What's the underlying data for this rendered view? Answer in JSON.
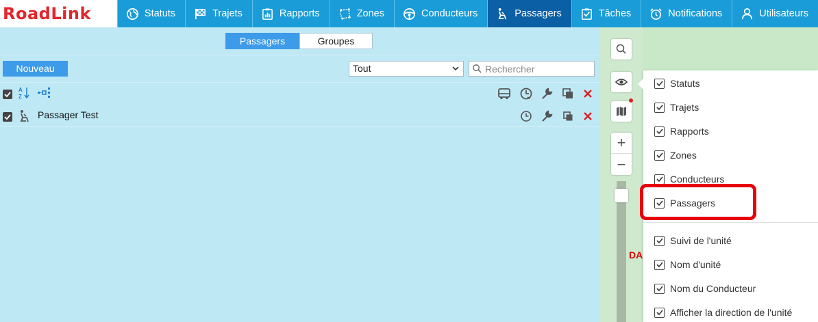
{
  "app": {
    "logo": "RoadLink"
  },
  "nav": {
    "items": [
      {
        "label": "Statuts",
        "icon": "globe-icon",
        "active": false
      },
      {
        "label": "Trajets",
        "icon": "checkered-flag-icon",
        "active": false
      },
      {
        "label": "Rapports",
        "icon": "report-icon",
        "active": false
      },
      {
        "label": "Zones",
        "icon": "zones-icon",
        "active": false
      },
      {
        "label": "Conducteurs",
        "icon": "steering-wheel-icon",
        "active": false
      },
      {
        "label": "Passagers",
        "icon": "seated-passenger-icon",
        "active": true
      },
      {
        "label": "Tâches",
        "icon": "task-check-icon",
        "active": false
      },
      {
        "label": "Notifications",
        "icon": "alarm-clock-icon",
        "active": false
      },
      {
        "label": "Utilisateurs",
        "icon": "user-icon",
        "active": false
      }
    ]
  },
  "panel": {
    "tabs": {
      "passengers": "Passagers",
      "groups": "Groupes",
      "active": "passengers"
    },
    "new_button": "Nouveau",
    "filter": {
      "value": "Tout"
    },
    "search": {
      "placeholder": "Rechercher",
      "value": ""
    },
    "passengers": [
      {
        "name": "Passager Test",
        "checked": true
      }
    ]
  },
  "layers": {
    "options": [
      {
        "label": "Statuts",
        "checked": true
      },
      {
        "label": "Trajets",
        "checked": true
      },
      {
        "label": "Rapports",
        "checked": true
      },
      {
        "label": "Zones",
        "checked": true
      },
      {
        "label": "Conducteurs",
        "checked": true
      },
      {
        "label": "Passagers",
        "checked": true,
        "highlighted": true
      },
      {
        "label": "Suivi de l'unité",
        "checked": true
      },
      {
        "label": "Nom d'unité",
        "checked": true
      },
      {
        "label": "Nom du Conducteur",
        "checked": true
      },
      {
        "label": "Afficher la direction de l'unité",
        "checked": true
      }
    ]
  },
  "map": {
    "label_fragment": "DA"
  },
  "colors": {
    "nav_bg": "#1a9cd8",
    "nav_active": "#0b5fa5",
    "panel_bg": "#bfe8f5",
    "accent": "#3d9be9",
    "logo_red": "#e3262c",
    "highlight": "#e8000b"
  }
}
